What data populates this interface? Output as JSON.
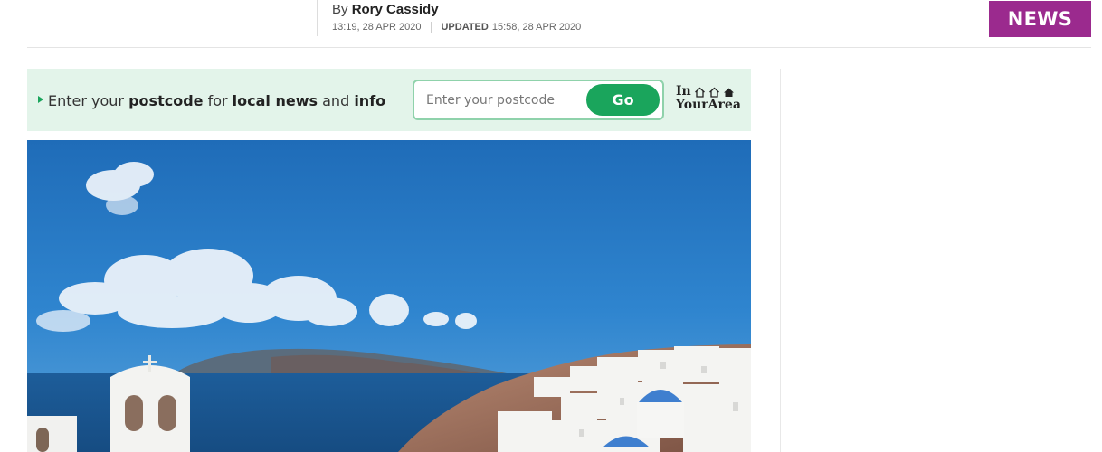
{
  "article": {
    "byline_prefix": "By",
    "author": "Rory Cassidy",
    "published": "13:19, 28 APR 2020",
    "updated_label": "UPDATED",
    "updated": "15:58, 28 APR 2020",
    "section_badge": "NEWS"
  },
  "postcode_widget": {
    "prompt_parts": [
      "Enter your ",
      "postcode",
      " for ",
      "local news",
      " and ",
      "info"
    ],
    "input_placeholder": "Enter your postcode",
    "go_label": "Go",
    "logo_line1": "In",
    "logo_line2": "YourArea"
  },
  "hero_image": {
    "alt": "Santorini"
  },
  "colors": {
    "badge": "#9b2a8e",
    "widget_bg": "#e3f4ea",
    "go_button": "#1aa55c"
  }
}
